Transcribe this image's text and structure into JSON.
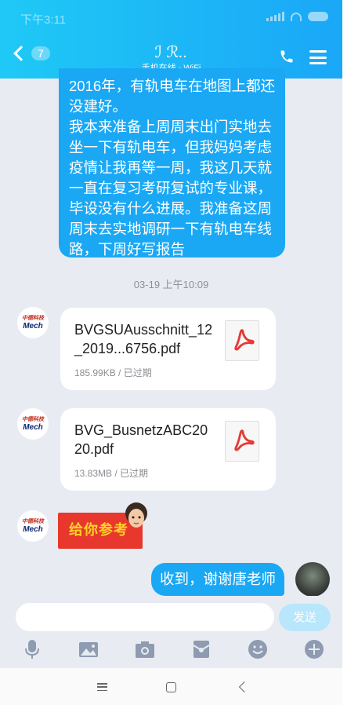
{
  "status_bar": {
    "time": "下午3:11"
  },
  "header": {
    "unread_count": "7",
    "contact_name": "ℐ ℛ..",
    "contact_status": "手机在线 - WiFi"
  },
  "messages": {
    "long_text": {
      "paragraphs": [
        "2016年，有轨电车在地图上都还没建好。",
        "我本来准备上周周末出门实地去坐一下有轨电车，但我妈妈考虑疫情让我再等一周，我这几天就一直在复习考研复试的专业课，毕设没有什么进展。我准备这周周末去实地调研一下有轨电车线路，下周好写报告"
      ]
    },
    "timestamp": "03-19 上午10:09",
    "file1": {
      "name": "BVGSUAusschnitt_12_2019...6756.pdf",
      "meta": "185.99KB / 已过期"
    },
    "file2": {
      "name": "BVG_BusnetzABC2020.pdf",
      "meta": "13.83MB / 已过期"
    },
    "sticker_text": "给你参考",
    "my_reply": "收到，谢谢唐老师"
  },
  "logo": {
    "top_text": "中德科技",
    "main_text": "Mech"
  },
  "input": {
    "placeholder": "",
    "send_label": "发送"
  },
  "toolbar": {
    "icons": [
      "microphone-icon",
      "image-icon",
      "camera-icon",
      "red-packet-icon",
      "emoji-icon",
      "plus-icon"
    ]
  },
  "colors": {
    "accent": "#1aa8f5",
    "header_start": "#1fc9f6",
    "header_end": "#1aa7f7",
    "background": "#e9ebf3"
  }
}
